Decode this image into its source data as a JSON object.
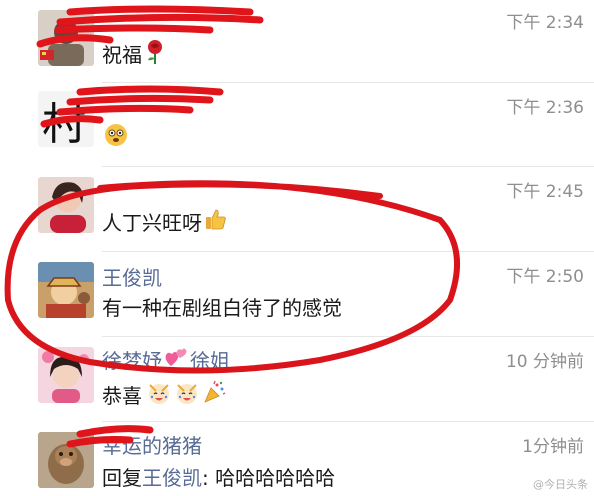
{
  "comments": [
    {
      "name": "",
      "time": "下午 2:34",
      "message": "祝福",
      "emoji_icons": [
        "rose-icon"
      ]
    },
    {
      "name": "",
      "time": "下午 2:36",
      "message": "",
      "emoji_icons": [
        "shocked-face-icon"
      ]
    },
    {
      "name": "",
      "time": "下午 2:45",
      "message": "人丁兴旺呀",
      "emoji_icons": [
        "thumbs-up-icon"
      ]
    },
    {
      "name": "王俊凯",
      "time": "下午 2:50",
      "message": "有一种在剧组白待了的感觉",
      "emoji_icons": []
    },
    {
      "name": "徐梦妤",
      "name_suffix": "徐姐",
      "time": "10 分钟前",
      "message": "恭喜",
      "emoji_icons": [
        "celebrate-face-icon",
        "celebrate-face-icon",
        "party-popper-icon"
      ]
    },
    {
      "name": "幸运的猪猪",
      "time": "1分钟前",
      "reply_prefix": "回复",
      "reply_target": "王俊凯",
      "message": ": 哈哈哈哈哈哈",
      "emoji_icons": []
    }
  ],
  "annotation_colors": {
    "redaction": "#e0141b",
    "circle": "#d9141b"
  }
}
